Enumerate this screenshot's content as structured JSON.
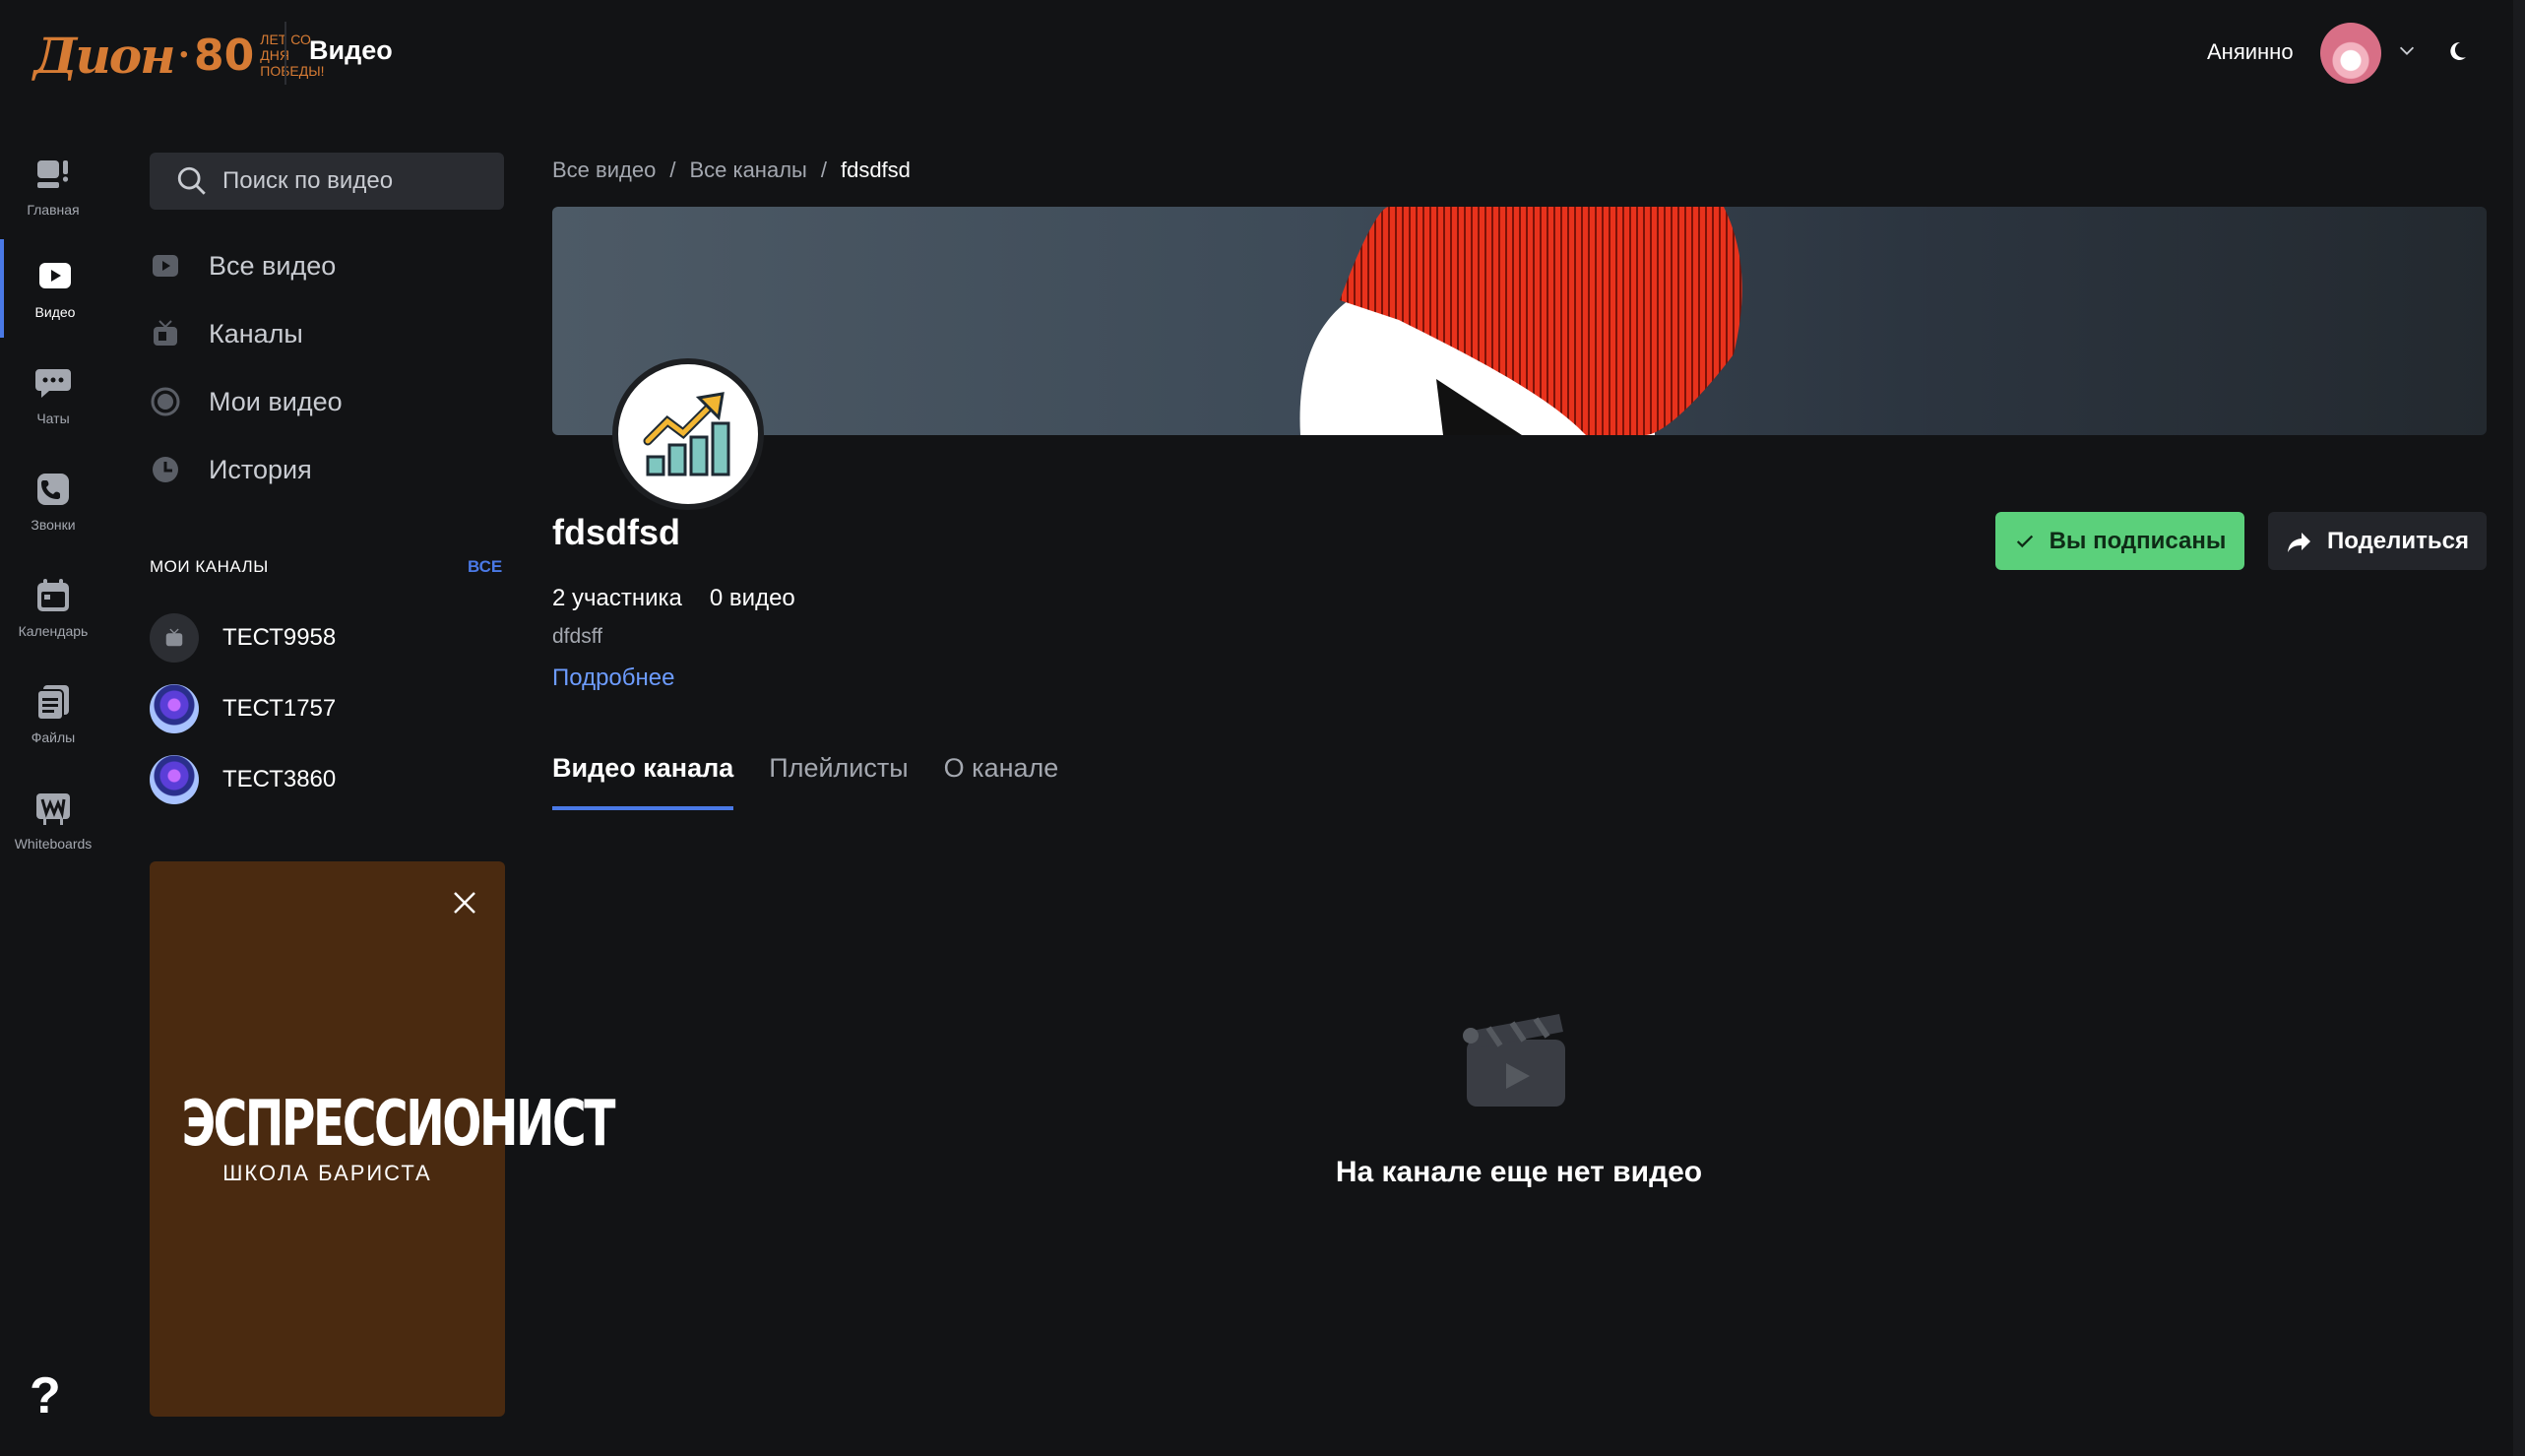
{
  "header": {
    "logo": {
      "brand": "Дион",
      "years": "80",
      "subtitle": "ЛЕТ СО ДНЯ ПОБЕДЫ!"
    },
    "section_title": "Видео",
    "user_name": "Аняинно"
  },
  "rail": [
    {
      "label": "Главная",
      "icon": "home-icon"
    },
    {
      "label": "Видео",
      "icon": "video-icon",
      "active": true
    },
    {
      "label": "Чаты",
      "icon": "chat-icon"
    },
    {
      "label": "Звонки",
      "icon": "calls-icon"
    },
    {
      "label": "Календарь",
      "icon": "calendar-icon"
    },
    {
      "label": "Файлы",
      "icon": "files-icon"
    },
    {
      "label": "Whiteboards",
      "icon": "whiteboard-icon"
    }
  ],
  "help_label": "?",
  "sidebar": {
    "search_placeholder": "Поиск по видео",
    "nav": [
      {
        "label": "Все видео",
        "icon": "play-square-icon"
      },
      {
        "label": "Каналы",
        "icon": "tv-icon"
      },
      {
        "label": "Мои видео",
        "icon": "record-icon"
      },
      {
        "label": "История",
        "icon": "clock-icon"
      }
    ],
    "my_channels_title": "МОИ КАНАЛЫ",
    "my_channels_all": "ВСЕ",
    "channels": [
      {
        "name": "ТЕСТ9958"
      },
      {
        "name": "ТЕСТ1757"
      },
      {
        "name": "ТЕСТ3860"
      }
    ],
    "promo": {
      "title": "ЭСПРЕССИОНИСТ",
      "subtitle": "ШКОЛА БАРИСТА"
    }
  },
  "breadcrumb": [
    "Все видео",
    "Все каналы",
    "fdsdfsd"
  ],
  "breadcrumb_sep": "/",
  "channel": {
    "name": "fdsdfsd",
    "members": "2 участника",
    "videos": "0 видео",
    "description": "dfdsff",
    "more_link": "Подробнее",
    "subscribed_label": "Вы подписаны",
    "share_label": "Поделиться"
  },
  "tabs": [
    {
      "label": "Видео канала",
      "active": true
    },
    {
      "label": "Плейлисты"
    },
    {
      "label": "О канале"
    }
  ],
  "empty_state": "На канале еще нет видео",
  "colors": {
    "accent": "#4a79e6",
    "subscribe": "#5bd07b",
    "logo": "#d67b34",
    "link": "#6d9cff"
  }
}
